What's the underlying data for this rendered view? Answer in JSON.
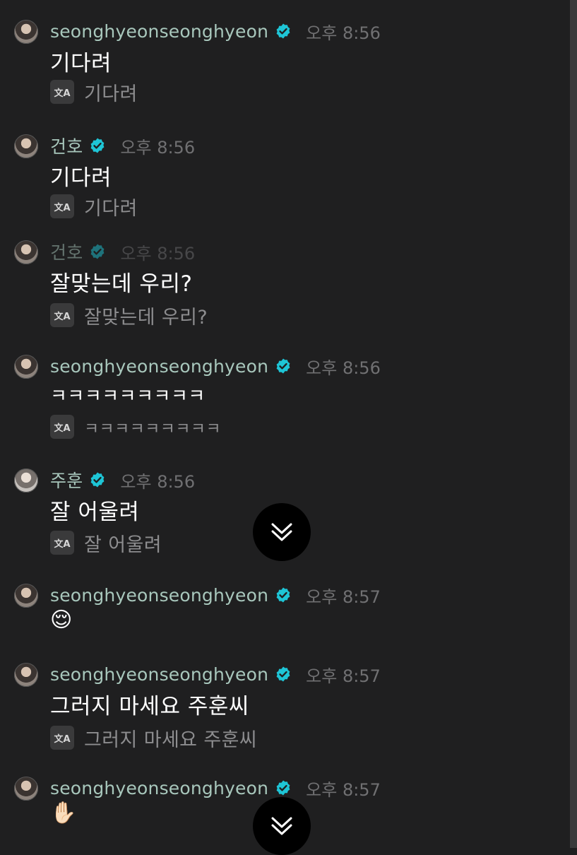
{
  "messages": [
    {
      "name": "seonghyeonseonghyeon",
      "time": "오후 8:56",
      "text": "기다려",
      "translation": "기다려"
    },
    {
      "name": "건호",
      "time": "오후 8:56",
      "text": "기다려",
      "translation": "기다려"
    },
    {
      "name": "건호",
      "time": "오후 8:56",
      "text": "잘맞는데 우리?",
      "translation": "잘맞는데 우리?"
    },
    {
      "name": "seonghyeonseonghyeon",
      "time": "오후 8:56",
      "text": "ㅋㅋㅋㅋㅋㅋㅋㅋㅋ",
      "translation": "ㅋㅋㅋㅋㅋㅋㅋㅋㅋ"
    },
    {
      "name": "주훈",
      "time": "오후 8:56",
      "text": "잘 어울려",
      "translation": "잘 어울려"
    },
    {
      "name": "seonghyeonseonghyeon",
      "time": "오후 8:57",
      "text": "😌"
    },
    {
      "name": "seonghyeonseonghyeon",
      "time": "오후 8:57",
      "text": "그러지 마세요 주훈씨",
      "translation": "그러지 마세요 주훈씨"
    },
    {
      "name": "seonghyeonseonghyeon",
      "time": "오후 8:57",
      "text": "✋🏻"
    }
  ],
  "translate_icon_label": "文A",
  "colors": {
    "background": "#1f1f20",
    "username": "#a8c7bc",
    "verified": "#1ec5d6",
    "timestamp": "#707072",
    "translation_text": "#8d8d8f"
  },
  "icons": {
    "verified": "verified-badge-icon",
    "translate": "translate-icon",
    "scroll_down": "double-chevron-down-icon"
  }
}
